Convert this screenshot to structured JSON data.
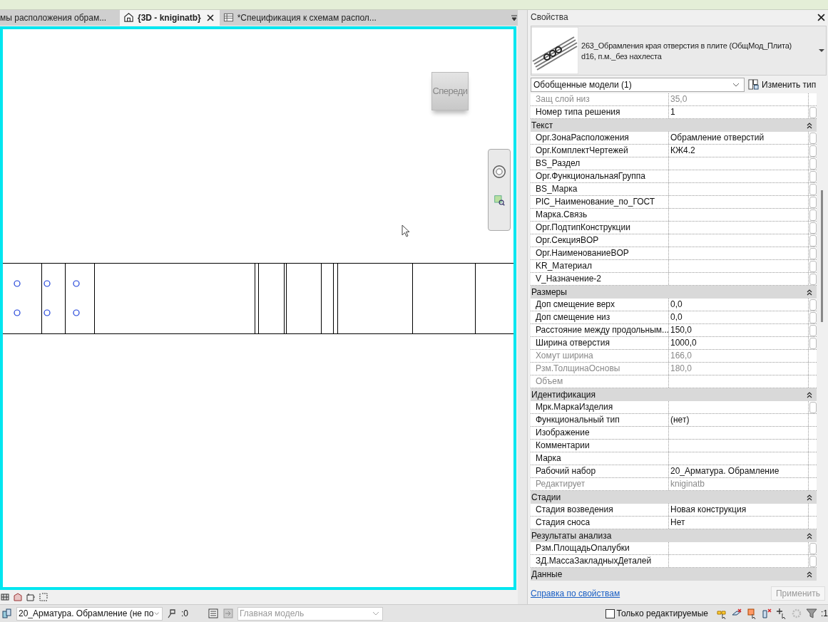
{
  "tabs": [
    {
      "label": "мы расположения  обрам...",
      "kind": "plain",
      "selected": false,
      "closable": false
    },
    {
      "label": "{3D - kniginatb}",
      "kind": "model",
      "selected": true,
      "closable": true
    },
    {
      "label": "*Спецификация к схемам распол...",
      "kind": "schedule",
      "selected": false,
      "closable": false
    }
  ],
  "viewport": {
    "viewcube_label": "Спереди"
  },
  "properties": {
    "title": "Свойства",
    "type_name": "263_Обрамления края отверстия в плите (ОбщМод_Плита)",
    "type_subname": "d16, п.м._без нахлеста",
    "category": "Обобщенные модели (1)",
    "edit_type": "Изменить тип",
    "groups": [
      {
        "rows": [
          {
            "name": "Защ слой низ",
            "value": "35,0",
            "readonly": true,
            "associable": false
          },
          {
            "name": "Номер типа решения",
            "value": "1",
            "readonly": false,
            "associable": true
          }
        ]
      },
      {
        "name": "Текст",
        "expanded": true,
        "rows": [
          {
            "name": "Орг.ЗонаРасположения",
            "value": "Обрамление отверстий",
            "readonly": false,
            "associable": true
          },
          {
            "name": "Орг.КомплектЧертежей",
            "value": "КЖ4.2",
            "readonly": false,
            "associable": true
          },
          {
            "name": "BS_Раздел",
            "readonly": false,
            "associable": true
          },
          {
            "name": "Орг.ФункциональнаяГруппа",
            "readonly": false,
            "associable": true
          },
          {
            "name": "BS_Марка",
            "readonly": false,
            "associable": true
          },
          {
            "name": "PIC_Наименование_по_ГОСТ",
            "readonly": false,
            "associable": true
          },
          {
            "name": "Марка.Связь",
            "readonly": false,
            "associable": true
          },
          {
            "name": "Орг.ПодтипКонструкции",
            "readonly": false,
            "associable": true
          },
          {
            "name": "Орг.СекцияBOP",
            "readonly": false,
            "associable": true
          },
          {
            "name": "Орг.НаименованиеBOP",
            "readonly": false,
            "associable": true
          },
          {
            "name": "KR_Материал",
            "readonly": false,
            "associable": true
          },
          {
            "name": "V_Назначение-2",
            "readonly": false,
            "associable": true
          }
        ]
      },
      {
        "name": "Размеры",
        "expanded": true,
        "rows": [
          {
            "name": "Доп смещение верх",
            "value": "0,0",
            "readonly": false,
            "associable": true
          },
          {
            "name": "Доп смещение низ",
            "value": "0,0",
            "readonly": false,
            "associable": true
          },
          {
            "name": "Расстояние между продольным...",
            "value": "150,0",
            "readonly": false,
            "associable": true
          },
          {
            "name": "Ширина отверстия",
            "value": "1000,0",
            "readonly": false,
            "associable": true
          },
          {
            "name": "Хомут ширина",
            "value": "166,0",
            "readonly": true,
            "associable": false
          },
          {
            "name": "Рзм.ТолщинаОсновы",
            "value": "180,0",
            "readonly": true,
            "associable": false
          },
          {
            "name": "Объем",
            "readonly": true,
            "associable": false
          }
        ]
      },
      {
        "name": "Идентификация",
        "expanded": true,
        "rows": [
          {
            "name": "Мрк.МаркаИзделия",
            "readonly": false,
            "associable": true
          },
          {
            "name": "Функциональный тип",
            "value": "(нет)",
            "readonly": false,
            "associable": false
          },
          {
            "name": "Изображение",
            "readonly": false,
            "associable": false
          },
          {
            "name": "Комментарии",
            "readonly": false,
            "associable": false
          },
          {
            "name": "Марка",
            "readonly": false,
            "associable": false
          },
          {
            "name": "Рабочий набор",
            "value": "20_Арматура. Обрамление",
            "readonly": false,
            "associable": false
          },
          {
            "name": "Редактирует",
            "value": "kniginatb",
            "readonly": true,
            "associable": false
          }
        ]
      },
      {
        "name": "Стадии",
        "expanded": true,
        "rows": [
          {
            "name": "Стадия возведения",
            "value": "Новая конструкция",
            "readonly": false,
            "associable": false
          },
          {
            "name": "Стадия сноса",
            "value": "Нет",
            "readonly": false,
            "associable": false
          }
        ]
      },
      {
        "name": "Результаты анализа",
        "expanded": true,
        "rows": [
          {
            "name": "Рзм.ПлощадьОпалубки",
            "readonly": false,
            "associable": true
          },
          {
            "name": "ЗД.МассаЗакладныхДеталей",
            "readonly": false,
            "associable": true
          }
        ]
      },
      {
        "name": "Данные",
        "expanded": true
      }
    ],
    "help_link": "Справка по свойствам",
    "apply": "Применить",
    "apply_disabled": true
  },
  "status_bar": {
    "workset": "20_Арматура. Обрамление (не по",
    "selection_count": ":0",
    "design_option": "Главная модель",
    "design_option_disabled": true,
    "editable_only": {
      "label": "Только редактируемые",
      "checked": false
    },
    "filter_count": ":1"
  }
}
